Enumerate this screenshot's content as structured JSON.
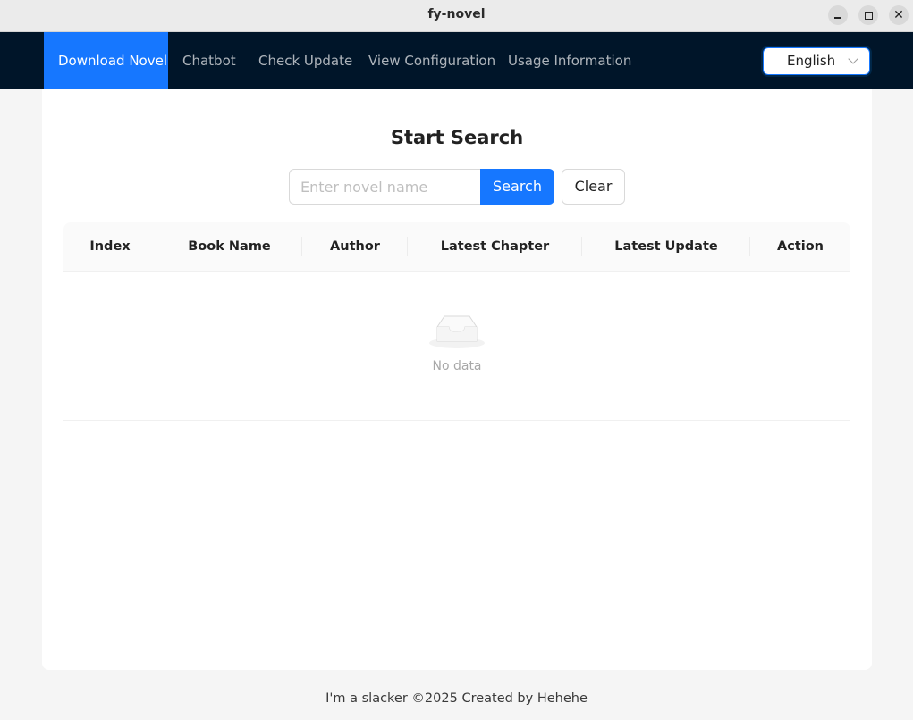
{
  "window": {
    "title": "fy-novel",
    "controls": [
      "minimize-icon",
      "maximize-icon",
      "close-icon"
    ]
  },
  "nav": {
    "items": [
      {
        "label": "Download Novel",
        "active": true
      },
      {
        "label": "Chatbot",
        "active": false
      },
      {
        "label": "Check Update",
        "active": false
      },
      {
        "label": "View Configuration",
        "active": false
      },
      {
        "label": "Usage Information",
        "active": false
      }
    ],
    "language": "English"
  },
  "search": {
    "heading": "Start Search",
    "placeholder": "Enter novel name",
    "value": "",
    "search_label": "Search",
    "clear_label": "Clear"
  },
  "table": {
    "columns": [
      "Index",
      "Book Name",
      "Author",
      "Latest Chapter",
      "Latest Update",
      "Action"
    ],
    "rows": [],
    "empty_text": "No data"
  },
  "footer": {
    "text": "I'm a slacker ©2025 Created by Hehehe"
  },
  "colors": {
    "nav_bg": "#001529",
    "accent": "#1677ff",
    "page_bg": "#f5f5f5"
  }
}
